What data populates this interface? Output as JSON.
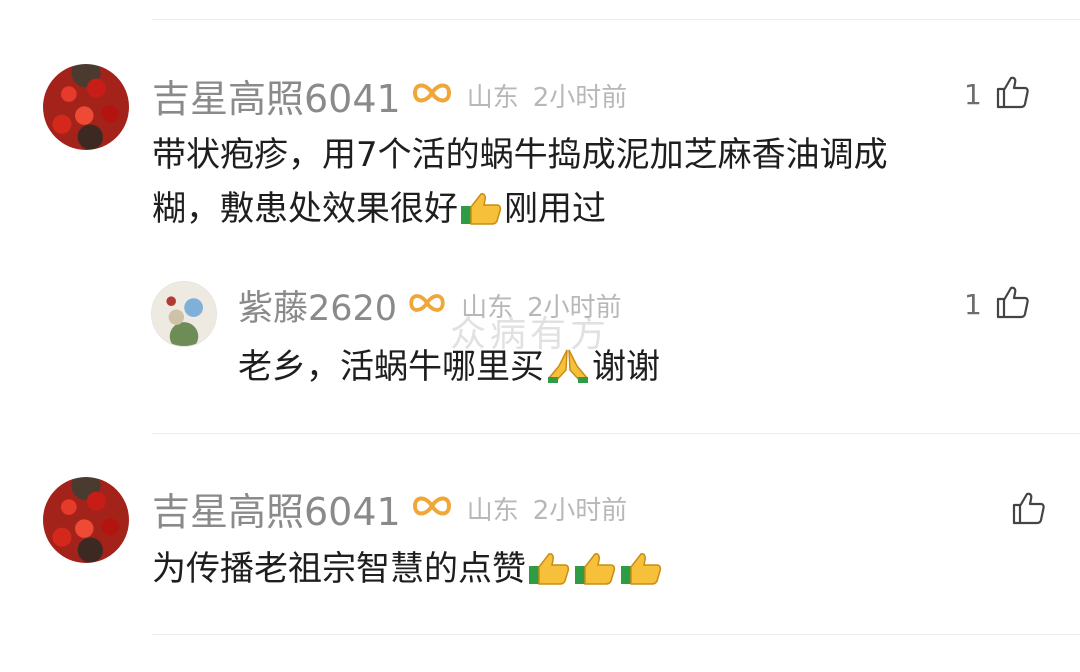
{
  "comments": [
    {
      "username": "吉星高照6041",
      "location": "山东",
      "time": "2小时前",
      "likes": "1",
      "content_parts": [
        "带状疱疹，用7个活的蜗牛捣成泥加芝麻香油调成",
        "糊，敷患处效果很好",
        "刚用过"
      ],
      "avatar_icon": "red-flowers-avatar",
      "badge_icon": "infinity-badge-icon",
      "like_icon": "thumbs-up-icon",
      "emoji_icons": [
        "thumbs-up-emoji"
      ]
    },
    {
      "username": "紫藤2620",
      "location": "山东",
      "time": "2小时前",
      "likes": "1",
      "content_parts": [
        "老乡，活蜗牛哪里买",
        "谢谢"
      ],
      "avatar_icon": "painting-avatar",
      "badge_icon": "infinity-badge-icon",
      "like_icon": "thumbs-up-icon",
      "emoji_icons": [
        "folded-hands-emoji"
      ]
    },
    {
      "username": "吉星高照6041",
      "location": "山东",
      "time": "2小时前",
      "likes": "",
      "content_parts": [
        "为传播老祖宗智慧的点赞"
      ],
      "avatar_icon": "red-flowers-avatar",
      "badge_icon": "infinity-badge-icon",
      "like_icon": "thumbs-up-icon",
      "emoji_icons": [
        "thumbs-up-emoji",
        "thumbs-up-emoji",
        "thumbs-up-emoji"
      ]
    }
  ],
  "watermark": "众病有方",
  "colors": {
    "username": "#8a8a8a",
    "meta": "#b8b8b8",
    "content": "#1e1e1e",
    "badge": "#f0a73a",
    "divider": "#ececec"
  }
}
